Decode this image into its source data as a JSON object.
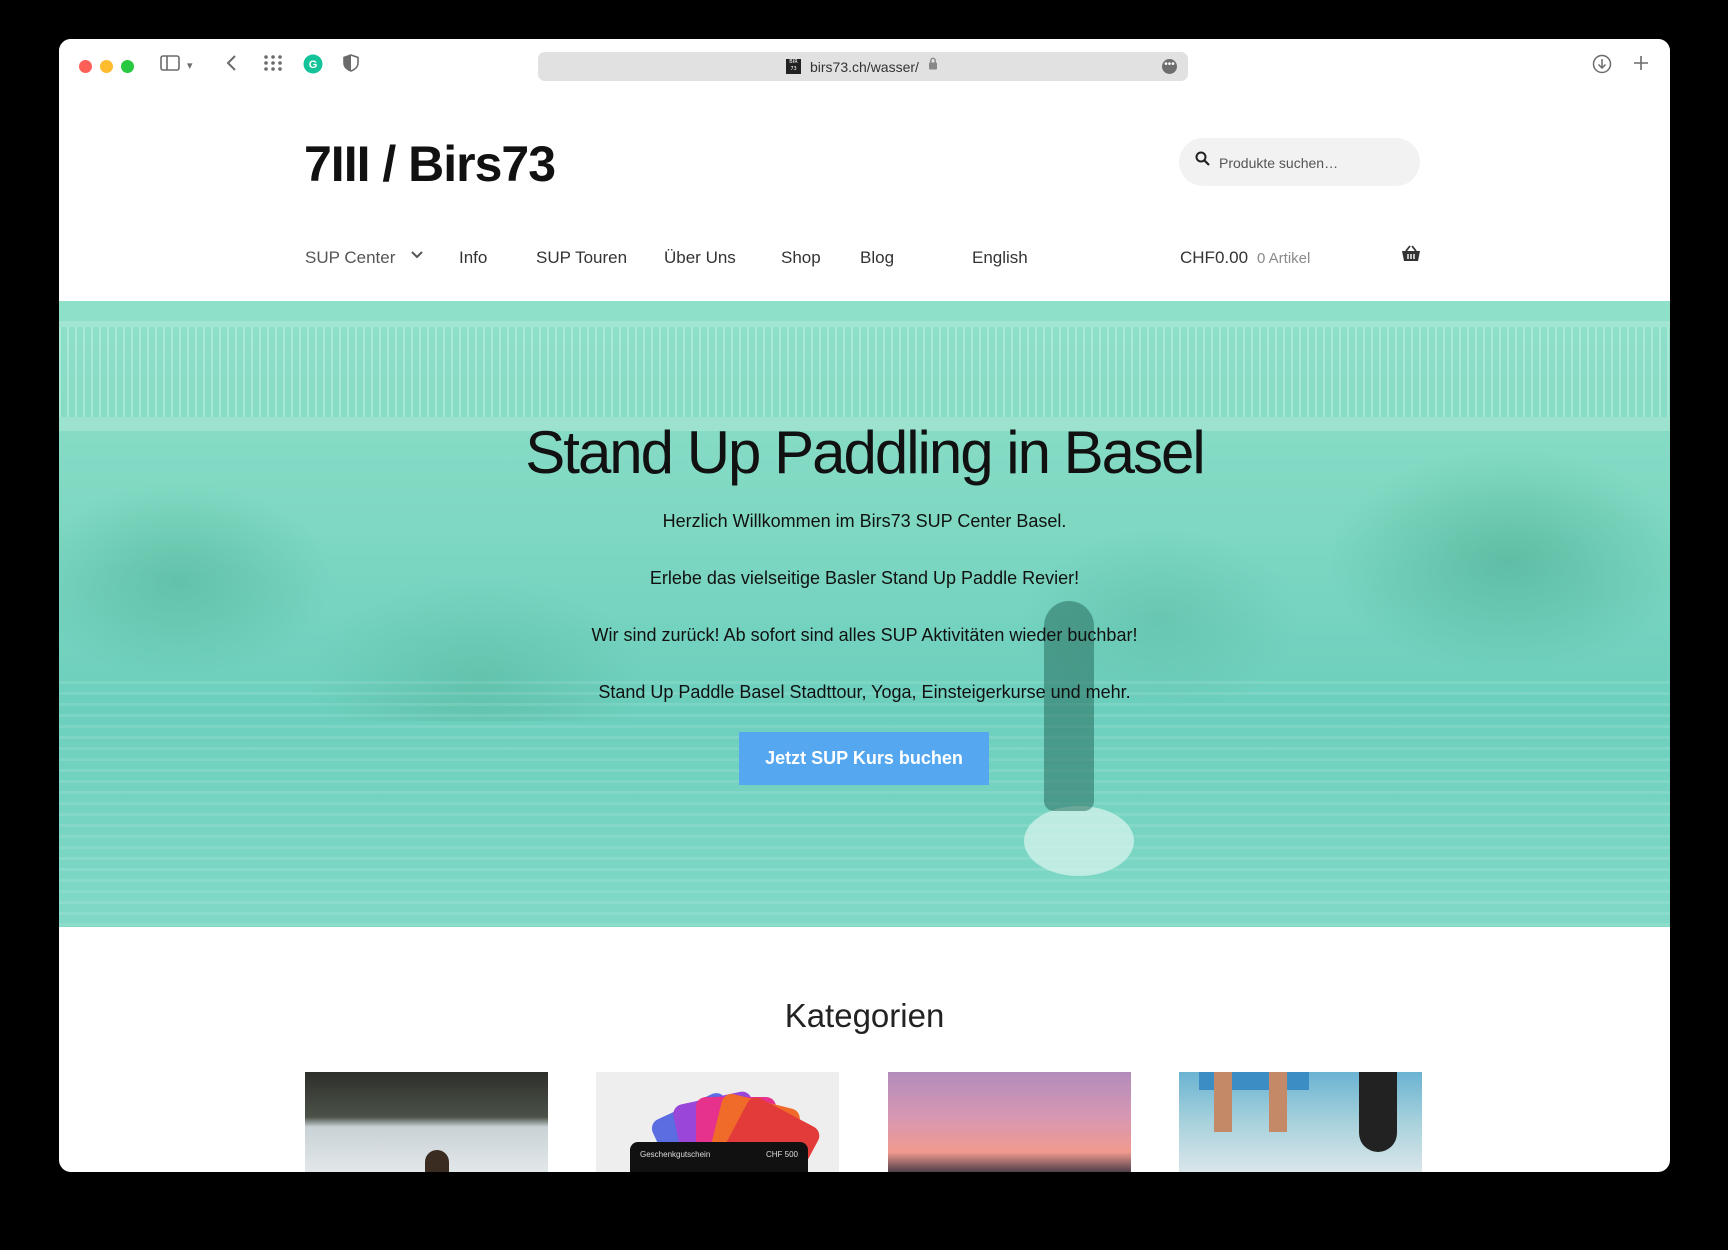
{
  "browser": {
    "url": "birs73.ch/wasser/",
    "favicon_text": "BIR 73"
  },
  "site": {
    "title": "7III / Birs73",
    "search_placeholder": "Produkte suchen…"
  },
  "nav": {
    "items": [
      "SUP Center",
      "Info",
      "SUP Touren",
      "Über Uns",
      "Shop",
      "Blog",
      "English"
    ]
  },
  "cart": {
    "amount": "CHF0.00",
    "count": "0 Artikel"
  },
  "hero": {
    "title": "Stand Up Paddling in Basel",
    "lines": [
      "Herzlich Willkommen im Birs73 SUP Center Basel.",
      "Erlebe das vielseitige Basler Stand Up Paddle Revier!",
      "Wir sind zurück! Ab sofort sind alles SUP Aktivitäten wieder buchbar!",
      "Stand Up Paddle Basel Stadttour, Yoga, Einsteigerkurse und mehr."
    ],
    "button": "Jetzt SUP Kurs buchen",
    "button_color": "#55a8f0",
    "tint_color": "#7fd8c2"
  },
  "categories": {
    "title": "Kategorien",
    "gift_card_label": "Geschenkgutschein",
    "gift_card_value": "CHF 500"
  }
}
